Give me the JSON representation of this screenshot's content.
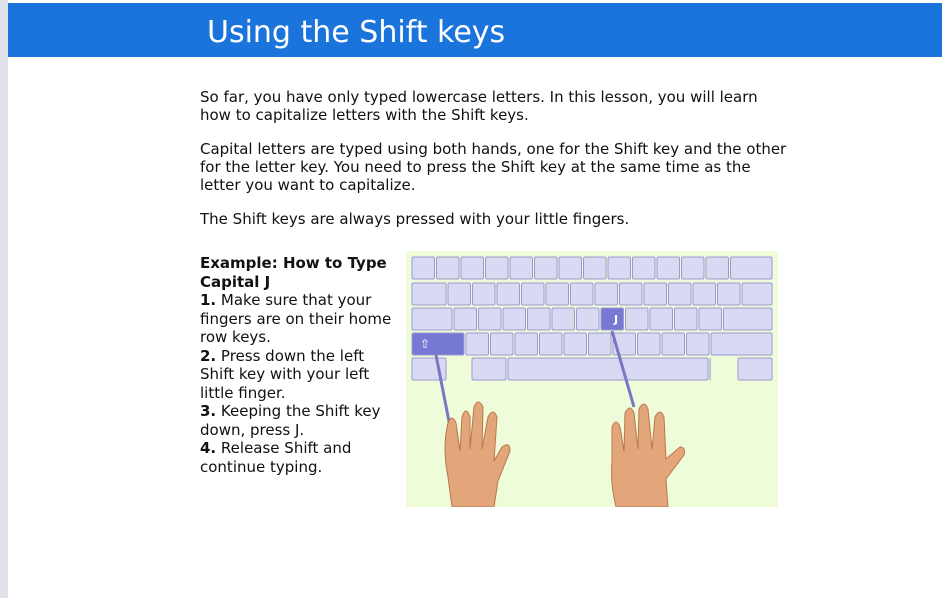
{
  "header": {
    "title": "Using the Shift keys",
    "bg_color": "#1a74db"
  },
  "paragraphs": [
    "So far, you have only typed lowercase letters. In this lesson, you will learn how to capitalize letters with the Shift keys.",
    "Capital letters are typed using both hands, one for the Shift key and the other for the letter key. You need to press the Shift key at the same time as the letter you want to capitalize.",
    "The Shift keys are always pressed with your little fingers."
  ],
  "example": {
    "heading": "Example: How to Type Capital J",
    "steps": [
      {
        "num": "1.",
        "text": "Make sure that your fingers are on their home row keys."
      },
      {
        "num": "2.",
        "text": "Press down the left Shift key with your left little finger."
      },
      {
        "num": "3.",
        "text": "Keeping the Shift key down, press J."
      },
      {
        "num": "4.",
        "text": "Release Shift and continue typing."
      }
    ]
  },
  "illustration": {
    "j_key_label": "J",
    "shift_key_label": "⇧",
    "icon": "keyboard-hands-illustration",
    "bg_color": "#eefcd9",
    "key_color": "#d9d9f4",
    "highlight_color": "#7777d4"
  }
}
